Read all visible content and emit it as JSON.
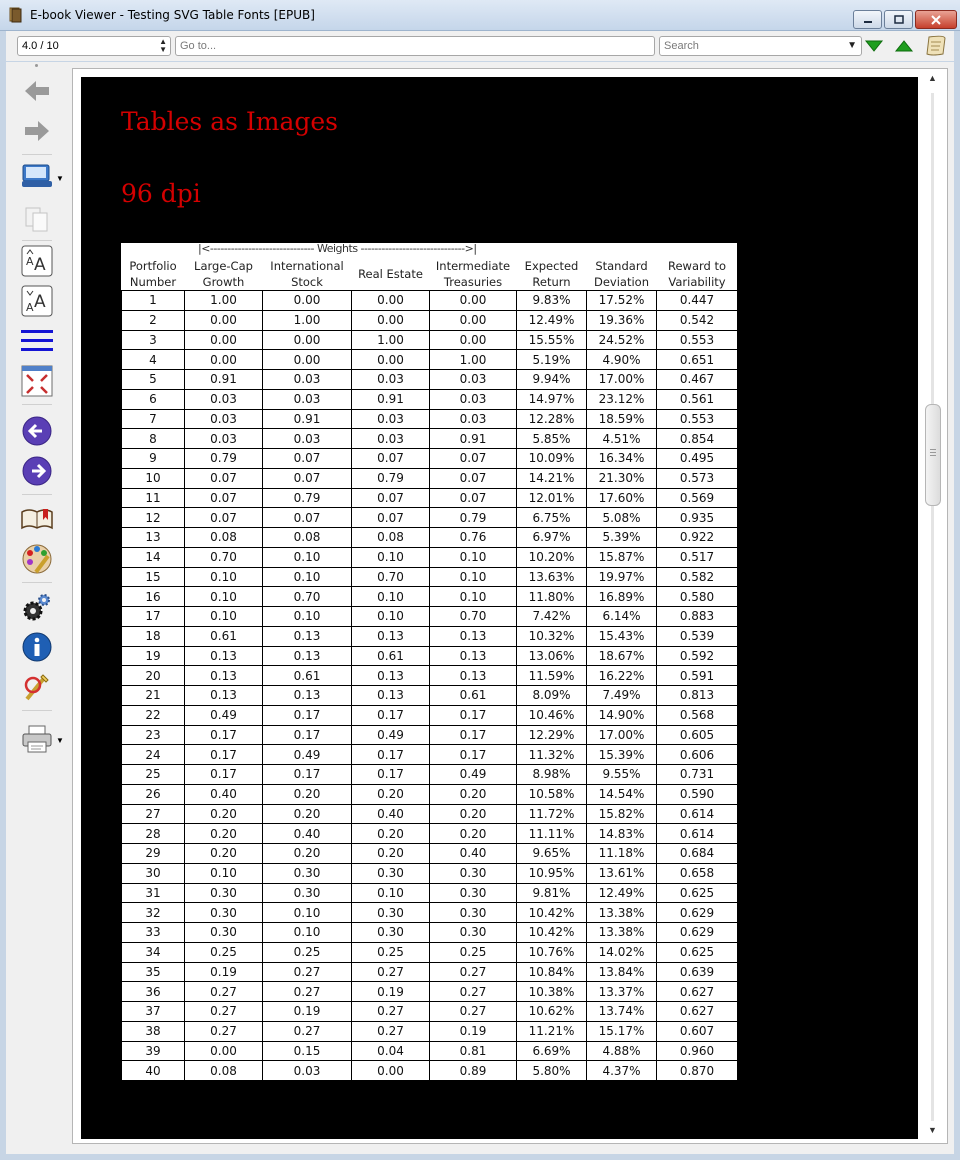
{
  "window": {
    "title": "E-book Viewer - Testing SVG Table Fonts [EPUB]"
  },
  "toolbar": {
    "position_value": "4.0 / 10",
    "goto_placeholder": "Go to...",
    "search_placeholder": "Search"
  },
  "colors": {
    "heading": "#d40000",
    "page_background": "#000000",
    "next_match_green": "#1e9e1e"
  },
  "side_toolbar": {
    "icons": [
      "back-icon",
      "forward-icon",
      "library-icon",
      "copy-icon",
      "font-larger-icon",
      "font-smaller-icon",
      "toc-icon",
      "fullscreen-icon",
      "previous-page-icon",
      "next-page-icon",
      "bookmarks-icon",
      "theme-icon",
      "preferences-icon",
      "info-icon",
      "debug-icon",
      "print-icon"
    ]
  },
  "content": {
    "heading1": "Tables as Images",
    "heading2": "96 dpi",
    "weights_label": "|<------------------------------ Weights ------------------------------>|",
    "headers": [
      [
        "Portfolio",
        "Number"
      ],
      [
        "Large-Cap",
        "Growth"
      ],
      [
        "International",
        "Stock"
      ],
      [
        "Real Estate",
        ""
      ],
      [
        "Intermediate",
        "Treasuries"
      ],
      [
        "Expected",
        "Return"
      ],
      [
        "Standard",
        "Deviation"
      ],
      [
        "Reward to",
        "Variability"
      ]
    ],
    "rows": [
      [
        "1",
        "1.00",
        "0.00",
        "0.00",
        "0.00",
        "9.83%",
        "17.52%",
        "0.447"
      ],
      [
        "2",
        "0.00",
        "1.00",
        "0.00",
        "0.00",
        "12.49%",
        "19.36%",
        "0.542"
      ],
      [
        "3",
        "0.00",
        "0.00",
        "1.00",
        "0.00",
        "15.55%",
        "24.52%",
        "0.553"
      ],
      [
        "4",
        "0.00",
        "0.00",
        "0.00",
        "1.00",
        "5.19%",
        "4.90%",
        "0.651"
      ],
      [
        "5",
        "0.91",
        "0.03",
        "0.03",
        "0.03",
        "9.94%",
        "17.00%",
        "0.467"
      ],
      [
        "6",
        "0.03",
        "0.03",
        "0.91",
        "0.03",
        "14.97%",
        "23.12%",
        "0.561"
      ],
      [
        "7",
        "0.03",
        "0.91",
        "0.03",
        "0.03",
        "12.28%",
        "18.59%",
        "0.553"
      ],
      [
        "8",
        "0.03",
        "0.03",
        "0.03",
        "0.91",
        "5.85%",
        "4.51%",
        "0.854"
      ],
      [
        "9",
        "0.79",
        "0.07",
        "0.07",
        "0.07",
        "10.09%",
        "16.34%",
        "0.495"
      ],
      [
        "10",
        "0.07",
        "0.07",
        "0.79",
        "0.07",
        "14.21%",
        "21.30%",
        "0.573"
      ],
      [
        "11",
        "0.07",
        "0.79",
        "0.07",
        "0.07",
        "12.01%",
        "17.60%",
        "0.569"
      ],
      [
        "12",
        "0.07",
        "0.07",
        "0.07",
        "0.79",
        "6.75%",
        "5.08%",
        "0.935"
      ],
      [
        "13",
        "0.08",
        "0.08",
        "0.08",
        "0.76",
        "6.97%",
        "5.39%",
        "0.922"
      ],
      [
        "14",
        "0.70",
        "0.10",
        "0.10",
        "0.10",
        "10.20%",
        "15.87%",
        "0.517"
      ],
      [
        "15",
        "0.10",
        "0.10",
        "0.70",
        "0.10",
        "13.63%",
        "19.97%",
        "0.582"
      ],
      [
        "16",
        "0.10",
        "0.70",
        "0.10",
        "0.10",
        "11.80%",
        "16.89%",
        "0.580"
      ],
      [
        "17",
        "0.10",
        "0.10",
        "0.10",
        "0.70",
        "7.42%",
        "6.14%",
        "0.883"
      ],
      [
        "18",
        "0.61",
        "0.13",
        "0.13",
        "0.13",
        "10.32%",
        "15.43%",
        "0.539"
      ],
      [
        "19",
        "0.13",
        "0.13",
        "0.61",
        "0.13",
        "13.06%",
        "18.67%",
        "0.592"
      ],
      [
        "20",
        "0.13",
        "0.61",
        "0.13",
        "0.13",
        "11.59%",
        "16.22%",
        "0.591"
      ],
      [
        "21",
        "0.13",
        "0.13",
        "0.13",
        "0.61",
        "8.09%",
        "7.49%",
        "0.813"
      ],
      [
        "22",
        "0.49",
        "0.17",
        "0.17",
        "0.17",
        "10.46%",
        "14.90%",
        "0.568"
      ],
      [
        "23",
        "0.17",
        "0.17",
        "0.49",
        "0.17",
        "12.29%",
        "17.00%",
        "0.605"
      ],
      [
        "24",
        "0.17",
        "0.49",
        "0.17",
        "0.17",
        "11.32%",
        "15.39%",
        "0.606"
      ],
      [
        "25",
        "0.17",
        "0.17",
        "0.17",
        "0.49",
        "8.98%",
        "9.55%",
        "0.731"
      ],
      [
        "26",
        "0.40",
        "0.20",
        "0.20",
        "0.20",
        "10.58%",
        "14.54%",
        "0.590"
      ],
      [
        "27",
        "0.20",
        "0.20",
        "0.40",
        "0.20",
        "11.72%",
        "15.82%",
        "0.614"
      ],
      [
        "28",
        "0.20",
        "0.40",
        "0.20",
        "0.20",
        "11.11%",
        "14.83%",
        "0.614"
      ],
      [
        "29",
        "0.20",
        "0.20",
        "0.20",
        "0.40",
        "9.65%",
        "11.18%",
        "0.684"
      ],
      [
        "30",
        "0.10",
        "0.30",
        "0.30",
        "0.30",
        "10.95%",
        "13.61%",
        "0.658"
      ],
      [
        "31",
        "0.30",
        "0.30",
        "0.10",
        "0.30",
        "9.81%",
        "12.49%",
        "0.625"
      ],
      [
        "32",
        "0.30",
        "0.10",
        "0.30",
        "0.30",
        "10.42%",
        "13.38%",
        "0.629"
      ],
      [
        "33",
        "0.30",
        "0.10",
        "0.30",
        "0.30",
        "10.42%",
        "13.38%",
        "0.629"
      ],
      [
        "34",
        "0.25",
        "0.25",
        "0.25",
        "0.25",
        "10.76%",
        "14.02%",
        "0.625"
      ],
      [
        "35",
        "0.19",
        "0.27",
        "0.27",
        "0.27",
        "10.84%",
        "13.84%",
        "0.639"
      ],
      [
        "36",
        "0.27",
        "0.27",
        "0.19",
        "0.27",
        "10.38%",
        "13.37%",
        "0.627"
      ],
      [
        "37",
        "0.27",
        "0.19",
        "0.27",
        "0.27",
        "10.62%",
        "13.74%",
        "0.627"
      ],
      [
        "38",
        "0.27",
        "0.27",
        "0.27",
        "0.19",
        "11.21%",
        "15.17%",
        "0.607"
      ],
      [
        "39",
        "0.00",
        "0.15",
        "0.04",
        "0.81",
        "6.69%",
        "4.88%",
        "0.960"
      ],
      [
        "40",
        "0.08",
        "0.03",
        "0.00",
        "0.89",
        "5.80%",
        "4.37%",
        "0.870"
      ]
    ]
  }
}
